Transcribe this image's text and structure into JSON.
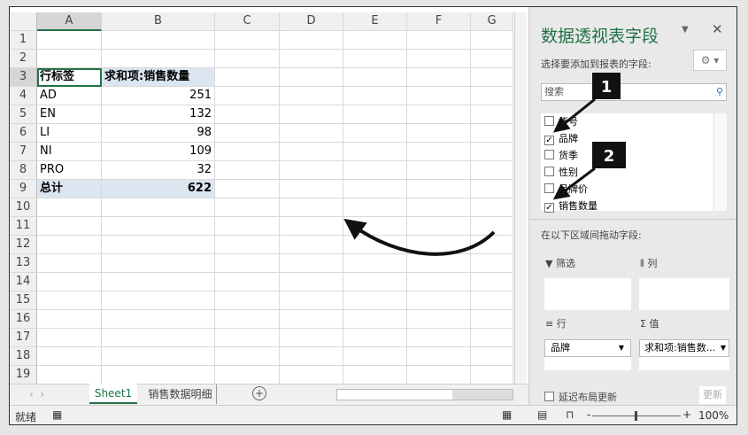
{
  "columns": [
    "A",
    "B",
    "C",
    "D",
    "E",
    "F",
    "G"
  ],
  "rows": [
    "1",
    "2",
    "3",
    "4",
    "5",
    "6",
    "7",
    "8",
    "9",
    "10",
    "11",
    "12",
    "13",
    "14",
    "15",
    "16",
    "17",
    "18",
    "19"
  ],
  "pivot": {
    "header_label": "行标签",
    "header_value": "求和项:销售数量",
    "items": [
      {
        "label": "AD",
        "value": "251"
      },
      {
        "label": "EN",
        "value": "132"
      },
      {
        "label": "LI",
        "value": "98"
      },
      {
        "label": "NI",
        "value": "109"
      },
      {
        "label": "PRO",
        "value": "32"
      }
    ],
    "total_label": "总计",
    "total_value": "622"
  },
  "sheets": [
    "Sheet1",
    "销售数据明细"
  ],
  "status": {
    "ready": "就绪",
    "zoom": "100%"
  },
  "pane": {
    "title": "数据透视表字段",
    "choose_label": "选择要添加到报表的字段:",
    "search_placeholder": "搜索",
    "fields": [
      {
        "name": "货号",
        "checked": false
      },
      {
        "name": "品牌",
        "checked": true
      },
      {
        "name": "货季",
        "checked": false
      },
      {
        "name": "性别",
        "checked": false
      },
      {
        "name": "吊牌价",
        "checked": false
      },
      {
        "name": "销售数量",
        "checked": true
      }
    ],
    "drag_label": "在以下区域间拖动字段:",
    "filter_label": "筛选",
    "columns_label": "列",
    "rows_label": "行",
    "values_label": "值",
    "rows_field": "品牌",
    "values_field": "求和项:销售数...",
    "defer_label": "延迟布局更新",
    "update_label": "更新"
  },
  "annotations": {
    "marker1": "1",
    "marker2": "2"
  }
}
